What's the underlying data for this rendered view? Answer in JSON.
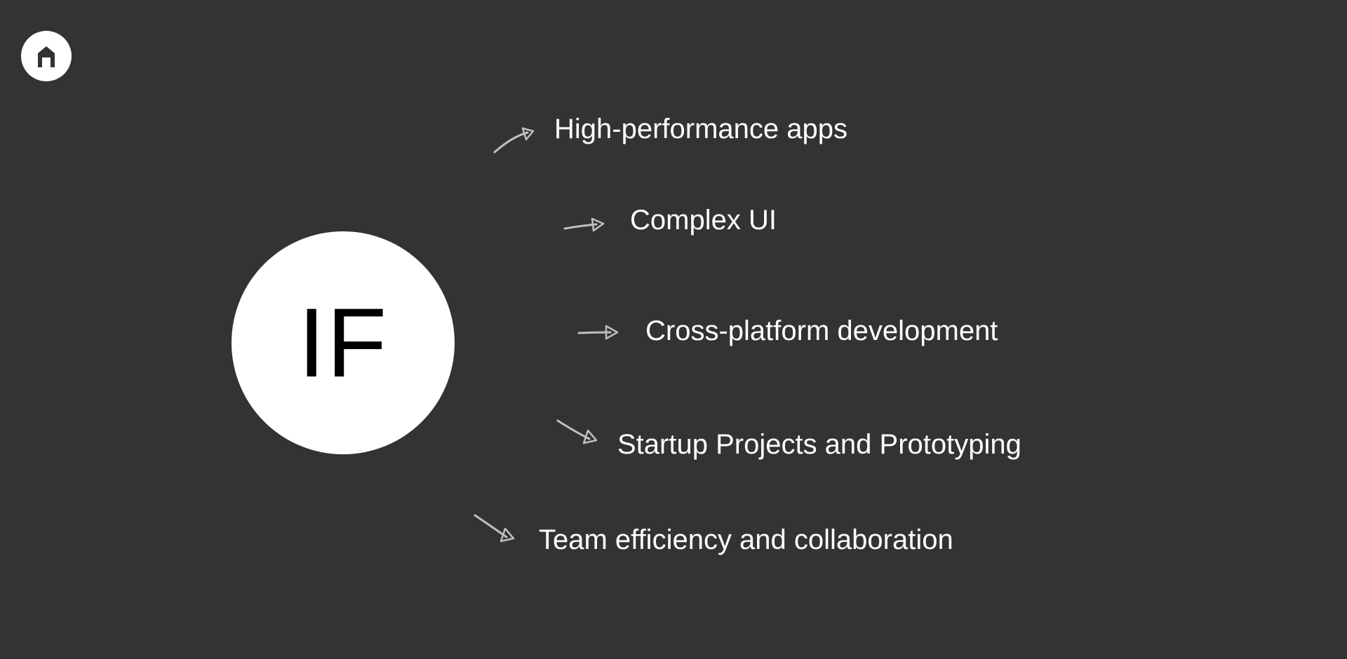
{
  "badge_label": "IF",
  "items": [
    {
      "text": "High-performance apps"
    },
    {
      "text": "Complex UI"
    },
    {
      "text": "Cross-platform development"
    },
    {
      "text": "Startup Projects and Prototyping"
    },
    {
      "text": "Team efficiency and collaboration"
    }
  ]
}
